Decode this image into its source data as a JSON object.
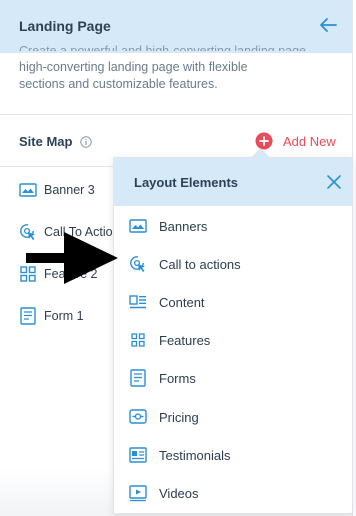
{
  "header": {
    "title": "Landing Page"
  },
  "description": {
    "clipped_line": "Create a powerful and high-converting landing page",
    "line1": "high-converting landing page with flexible",
    "line2": "sections and customizable features."
  },
  "sitemap": {
    "title": "Site Map",
    "add_new_label": "Add New",
    "items": [
      {
        "label": "Banner 3",
        "icon": "banner-icon"
      },
      {
        "label": "Call To Action",
        "icon": "call-to-action-icon"
      },
      {
        "label": "Feature 2",
        "icon": "features-icon"
      },
      {
        "label": "Form 1",
        "icon": "form-icon"
      }
    ]
  },
  "dropdown": {
    "title": "Layout Elements",
    "items": [
      {
        "label": "Banners",
        "icon": "banner-icon"
      },
      {
        "label": "Call to actions",
        "icon": "call-to-action-icon"
      },
      {
        "label": "Content",
        "icon": "content-icon"
      },
      {
        "label": "Features",
        "icon": "features-icon"
      },
      {
        "label": "Forms",
        "icon": "form-icon"
      },
      {
        "label": "Pricing",
        "icon": "pricing-icon"
      },
      {
        "label": "Testimonials",
        "icon": "testimonials-icon"
      },
      {
        "label": "Videos",
        "icon": "video-icon"
      }
    ]
  },
  "colors": {
    "header_bg": "#d6e9f8",
    "accent_blue": "#2a8fd6",
    "add_new_red": "#e84c5a",
    "text_dark": "#2c4257"
  }
}
